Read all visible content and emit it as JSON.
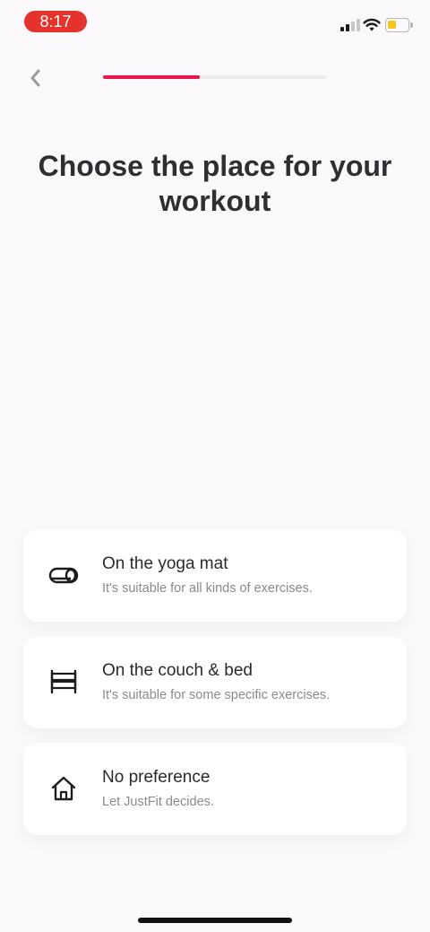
{
  "status_bar": {
    "time": "8:17",
    "signal_bars": 4,
    "signal_bars_active": 2,
    "battery_level_fraction": 0.45
  },
  "nav": {
    "back_icon": "chevron-left-icon",
    "progress_fraction": 0.43
  },
  "title": "Choose the place for your workout",
  "options": [
    {
      "icon": "yoga-mat-icon",
      "title": "On the yoga mat",
      "description": "It's suitable for all kinds of exercises."
    },
    {
      "icon": "bed-icon",
      "title": "On the couch & bed",
      "description": "It's suitable for some specific exercises."
    },
    {
      "icon": "home-icon",
      "title": "No preference",
      "description": "Let JustFit decides."
    }
  ],
  "colors": {
    "accent": "#e8184f",
    "time_pill": "#e5322d",
    "background": "#fbf9fb",
    "card": "#ffffff"
  }
}
